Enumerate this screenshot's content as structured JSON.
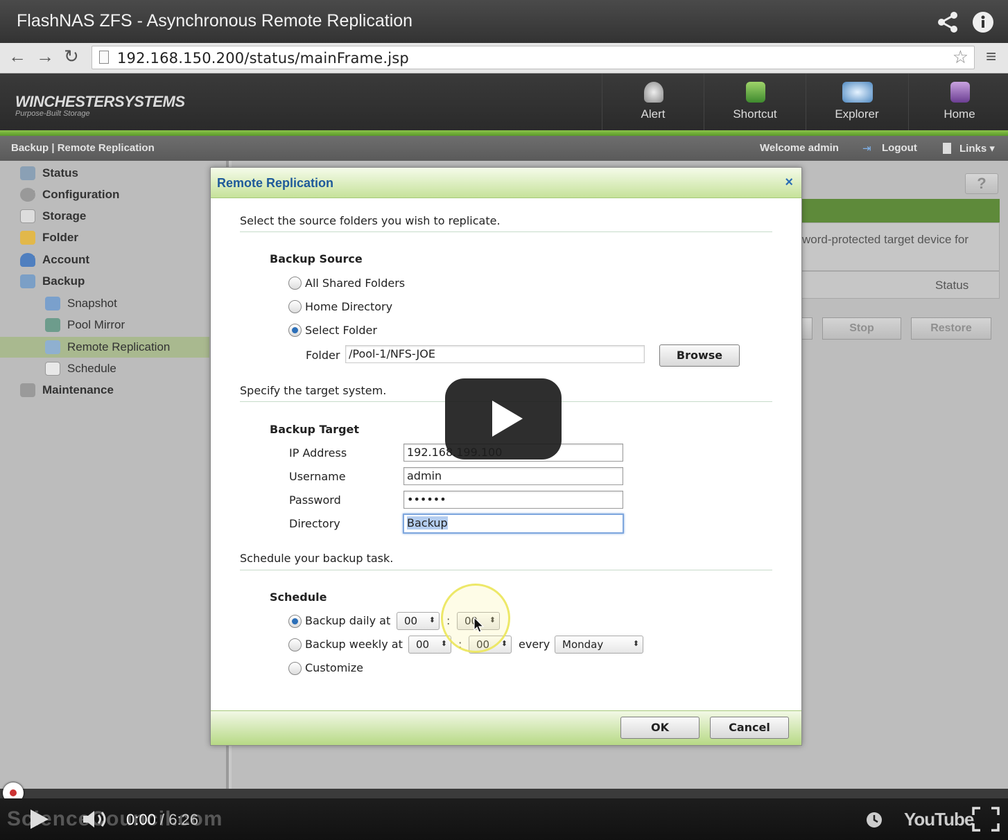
{
  "video": {
    "title": "FlashNAS ZFS - Asynchronous Remote Replication",
    "current_time": "0:00",
    "separator": "/",
    "duration": "6:26",
    "watermark": "ScienceCouncil.com",
    "youtube_logo": "YouTube"
  },
  "browser": {
    "url": "192.168.150.200/status/mainFrame.jsp"
  },
  "app": {
    "logo": "WINCHESTERSYSTEMS",
    "logo_sub": "Purpose-Built Storage",
    "nav": [
      {
        "label": "Alert"
      },
      {
        "label": "Shortcut"
      },
      {
        "label": "Explorer"
      },
      {
        "label": "Home"
      }
    ],
    "breadcrumb": "Backup | Remote Replication",
    "welcome": "Welcome admin",
    "logout": "Logout",
    "links": "Links ▾"
  },
  "sidebar": [
    {
      "label": "Status"
    },
    {
      "label": "Configuration"
    },
    {
      "label": "Storage"
    },
    {
      "label": "Folder"
    },
    {
      "label": "Account"
    },
    {
      "label": "Backup"
    },
    {
      "label": "Snapshot"
    },
    {
      "label": "Pool Mirror"
    },
    {
      "label": "Remote Replication"
    },
    {
      "label": "Schedule"
    },
    {
      "label": "Maintenance"
    }
  ],
  "background_panel": {
    "help": "?",
    "text": "word-protected target device for",
    "column": "Status",
    "stop": "Stop",
    "restore": "Restore"
  },
  "dialog": {
    "title": "Remote Replication",
    "close": "×",
    "source_intro": "Select the source folders you wish to replicate.",
    "source_heading": "Backup Source",
    "source_options": [
      "All Shared Folders",
      "Home Directory",
      "Select Folder"
    ],
    "folder_label": "Folder",
    "folder_value": "/Pool-1/NFS-JOE",
    "browse": "Browse",
    "target_intro": "Specify the target system.",
    "target_heading": "Backup Target",
    "ip_label": "IP Address",
    "ip_value": "192.168.199.100",
    "user_label": "Username",
    "user_value": "admin",
    "pass_label": "Password",
    "pass_value": "••••••",
    "dir_label": "Directory",
    "dir_value": "Backup",
    "schedule_intro": "Schedule your backup task.",
    "schedule_heading": "Schedule",
    "daily_label": "Backup daily at",
    "daily_h": "00",
    "daily_m": "00",
    "weekly_label": "Backup weekly at",
    "weekly_h": "00",
    "weekly_m": "00",
    "colon": ":",
    "every": "every",
    "weekday": "Monday",
    "customize": "Customize",
    "ok": "OK",
    "cancel": "Cancel"
  }
}
